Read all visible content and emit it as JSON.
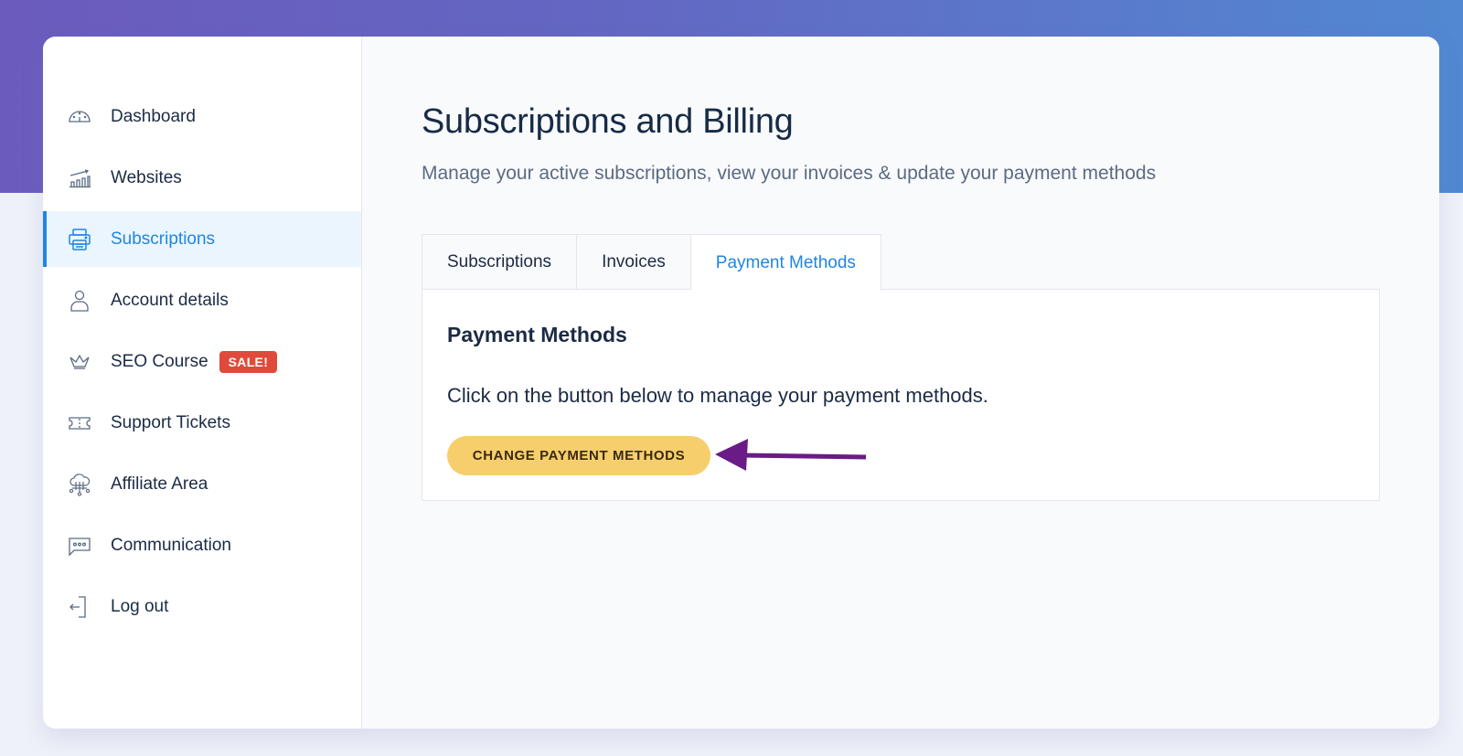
{
  "sidebar": {
    "items": [
      {
        "label": "Dashboard",
        "icon": "dashboard-gauge-icon",
        "active": false
      },
      {
        "label": "Websites",
        "icon": "bar-chart-trend-icon",
        "active": false
      },
      {
        "label": "Subscriptions",
        "icon": "printer-icon",
        "active": true
      },
      {
        "label": "Account details",
        "icon": "user-icon",
        "active": false
      },
      {
        "label": "SEO Course",
        "icon": "crown-icon",
        "active": false,
        "badge": "SALE!"
      },
      {
        "label": "Support Tickets",
        "icon": "ticket-icon",
        "active": false
      },
      {
        "label": "Affiliate Area",
        "icon": "cloud-network-icon",
        "active": false
      },
      {
        "label": "Communication",
        "icon": "chat-bubble-icon",
        "active": false
      },
      {
        "label": "Log out",
        "icon": "logout-icon",
        "active": false
      }
    ]
  },
  "header": {
    "title": "Subscriptions and Billing",
    "subtitle": "Manage your active subscriptions, view your invoices & update your payment methods"
  },
  "tabs": [
    {
      "label": "Subscriptions",
      "active": false
    },
    {
      "label": "Invoices",
      "active": false
    },
    {
      "label": "Payment Methods",
      "active": true
    }
  ],
  "panel": {
    "title": "Payment Methods",
    "text": "Click on the button below to manage your payment methods.",
    "button_label": "CHANGE PAYMENT METHODS"
  },
  "colors": {
    "accent": "#1f86e0",
    "button": "#f6cf6c",
    "badge": "#e04a3a",
    "arrow": "#6a1b86",
    "gradient_start": "#6b5bbd",
    "gradient_end": "#5188d1"
  }
}
